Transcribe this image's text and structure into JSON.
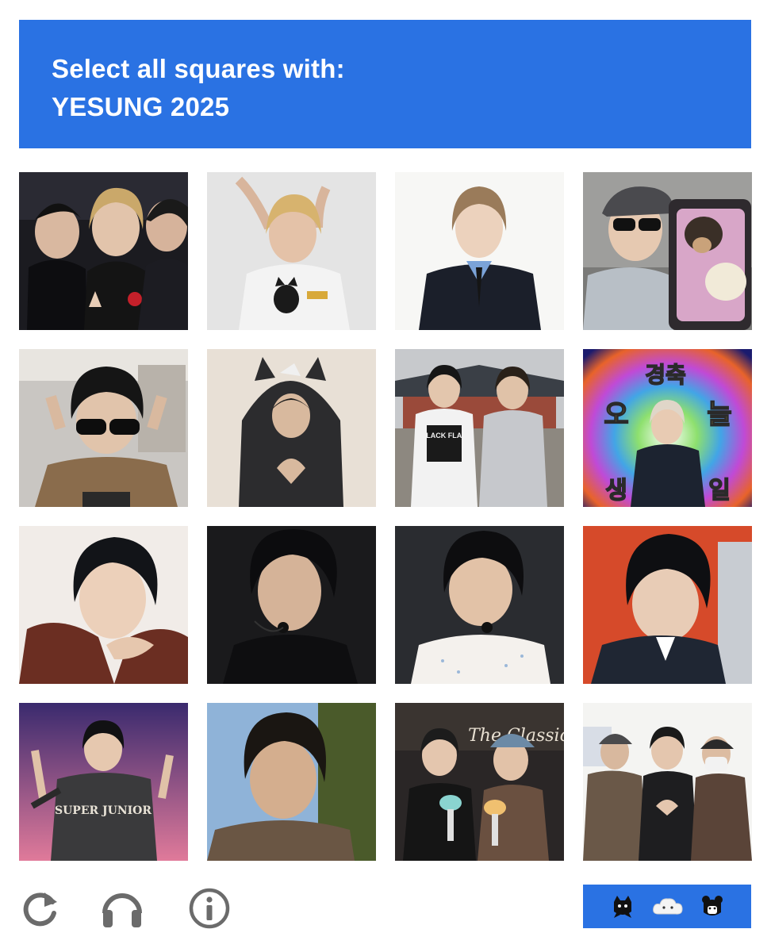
{
  "prompt": {
    "line1": "Select all squares with:",
    "line2": "YESUNG 2025"
  },
  "colors": {
    "accent": "#2a72e3",
    "icon_gray": "#6b6b6b"
  },
  "tiles": [
    {
      "name": "tile-1",
      "alt": "three members on stage"
    },
    {
      "name": "tile-2",
      "alt": "blond hair heart pose"
    },
    {
      "name": "tile-3",
      "alt": "suit portrait white background"
    },
    {
      "name": "tile-4",
      "alt": "selfie with dogs"
    },
    {
      "name": "tile-5",
      "alt": "sunglasses in clothing store"
    },
    {
      "name": "tile-6",
      "alt": "hoodie with ears heart hands"
    },
    {
      "name": "tile-7",
      "alt": "two members at palace"
    },
    {
      "name": "tile-8",
      "alt": "birthday congratulation graphic"
    },
    {
      "name": "tile-9",
      "alt": "close up portrait red jacket"
    },
    {
      "name": "tile-10",
      "alt": "dark selfie with headset"
    },
    {
      "name": "tile-11",
      "alt": "selfie with headset white shirt"
    },
    {
      "name": "tile-12",
      "alt": "portrait with red background"
    },
    {
      "name": "tile-13",
      "alt": "stage peace signs super junior shirt"
    },
    {
      "name": "tile-14",
      "alt": "outdoor selfie with trees"
    },
    {
      "name": "tile-15",
      "alt": "two members holding lightsticks"
    },
    {
      "name": "tile-16",
      "alt": "three members heart pose"
    }
  ],
  "tile_texts": {
    "t8_top": "경축",
    "t8_mid_left": "오",
    "t8_mid_right": "늘",
    "t8_bot_left": "생",
    "t8_bot_right": "일",
    "t7_shirt": "BLACK FLAG",
    "t13_shirt": "SUPER JUNIOR",
    "t15_sign": "The Classic"
  },
  "footer": {
    "reload_icon": "reload-icon",
    "audio_icon": "headphones-icon",
    "info_icon": "info-icon"
  }
}
